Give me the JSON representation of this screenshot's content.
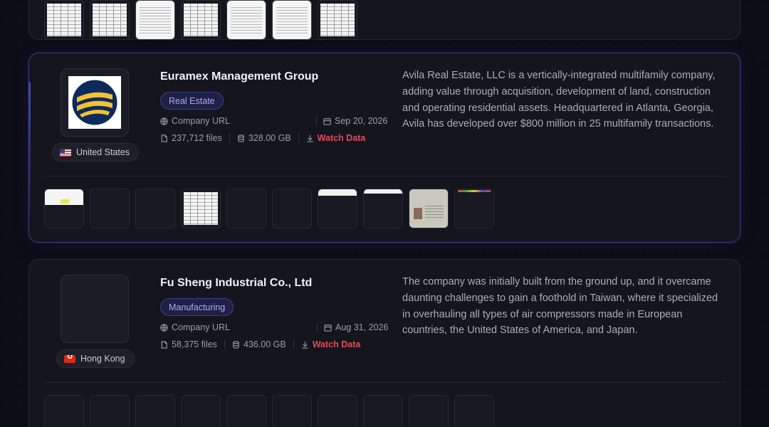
{
  "companies": [
    {
      "name": "Euramex Management Group",
      "category": "Real Estate",
      "country": "United States",
      "company_url_label": "Company URL",
      "date": "Sep 20, 2026",
      "files": "237,712 files",
      "size": "328.00 GB",
      "watch_label": "Watch Data",
      "description": "Avila Real Estate, LLC is a vertically-integrated multifamily company, adding value through acquisition, development of land, construction and operating residential assets. Headquartered in Atlanta, Georgia, Avila has developed over $800 million in 25 multifamily transactions."
    },
    {
      "name": "Fu Sheng Industrial Co., Ltd",
      "category": "Manufacturing",
      "country": "Hong Kong",
      "company_url_label": "Company URL",
      "date": "Aug 31, 2026",
      "files": "58,375 files",
      "size": "436.00 GB",
      "watch_label": "Watch Data",
      "description": "The company was initially built from the ground up, and it overcame daunting challenges to gain a foothold in Taiwan, where it specialized in overhauling all types of air compressors made in European countries, the United States of America, and Japan."
    }
  ],
  "icons": {
    "globe": "globe-icon",
    "calendar": "calendar-icon",
    "file": "file-icon",
    "database": "database-icon",
    "download": "download-icon"
  },
  "colors": {
    "accent_tag_bg": "#1f2046",
    "accent_tag_text": "#a8adf4",
    "watch_red": "#e14b5a"
  }
}
